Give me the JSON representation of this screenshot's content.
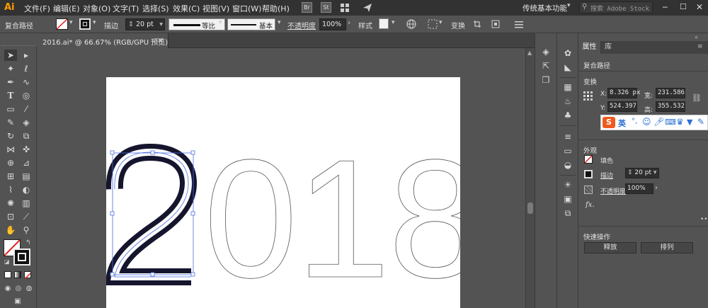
{
  "menubar": {
    "logo": "Ai",
    "items": [
      "文件(F)",
      "编辑(E)",
      "对象(O)",
      "文字(T)",
      "选择(S)",
      "效果(C)",
      "视图(V)",
      "窗口(W)",
      "帮助(H)"
    ],
    "bridge": "Br",
    "stock": "St",
    "workspace": "传统基本功能",
    "search_placeholder": "搜索 Adobe Stock"
  },
  "options": {
    "selection_type": "复合路径",
    "stroke_label": "描边",
    "stroke_value": "20 pt",
    "profile_label": "等比",
    "brush_label": "基本",
    "opacity_label": "不透明度",
    "opacity_value": "100%",
    "style_label": "样式",
    "transform_label": "变换"
  },
  "document": {
    "tab_title": "2016.ai* @ 66.67% (RGB/GPU 预览)",
    "close": "×",
    "artwork_text": "2018",
    "selected_digit": "2",
    "other_digits": "018"
  },
  "panel": {
    "tabs": [
      "属性",
      "库"
    ],
    "object_type": "复合路径",
    "transform_title": "变换",
    "x_label": "X:",
    "x_value": "8.326 px",
    "y_label": "Y:",
    "y_value": "524.397",
    "w_label": "宽:",
    "w_value": "231.586",
    "h_label": "高:",
    "h_value": "355.532",
    "appearance_title": "外观",
    "fill_label": "填色",
    "stroke_label": "描边",
    "stroke_value": "20 pt",
    "opacity_label": "不透明度",
    "opacity_value": "100%",
    "fx_label": "fx.",
    "quick_actions_title": "快速操作",
    "release_button": "释放",
    "arrange_button": "排列"
  },
  "ime": {
    "logo": "S",
    "mode": "英"
  },
  "colors": {
    "menubar_bg": "#323232",
    "workspace_bg": "#535353",
    "artboard_bg": "#ffffff",
    "selection_color": "#4a6ee0",
    "stroke_outline": "#1a1a3a"
  }
}
